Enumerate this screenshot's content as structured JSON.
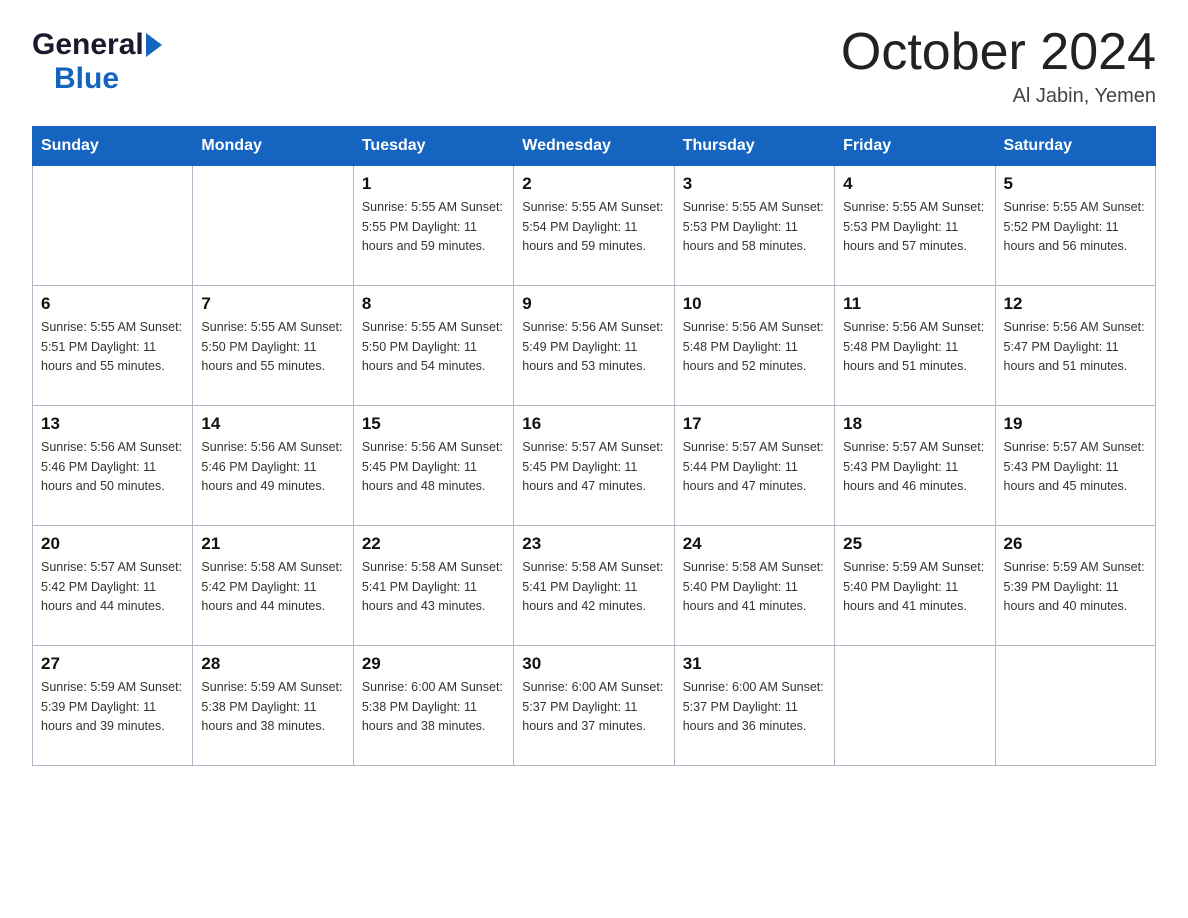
{
  "header": {
    "logo_general": "General",
    "logo_blue": "Blue",
    "title": "October 2024",
    "location": "Al Jabin, Yemen"
  },
  "weekdays": [
    "Sunday",
    "Monday",
    "Tuesday",
    "Wednesday",
    "Thursday",
    "Friday",
    "Saturday"
  ],
  "weeks": [
    [
      {
        "day": "",
        "info": ""
      },
      {
        "day": "",
        "info": ""
      },
      {
        "day": "1",
        "info": "Sunrise: 5:55 AM\nSunset: 5:55 PM\nDaylight: 11 hours\nand 59 minutes."
      },
      {
        "day": "2",
        "info": "Sunrise: 5:55 AM\nSunset: 5:54 PM\nDaylight: 11 hours\nand 59 minutes."
      },
      {
        "day": "3",
        "info": "Sunrise: 5:55 AM\nSunset: 5:53 PM\nDaylight: 11 hours\nand 58 minutes."
      },
      {
        "day": "4",
        "info": "Sunrise: 5:55 AM\nSunset: 5:53 PM\nDaylight: 11 hours\nand 57 minutes."
      },
      {
        "day": "5",
        "info": "Sunrise: 5:55 AM\nSunset: 5:52 PM\nDaylight: 11 hours\nand 56 minutes."
      }
    ],
    [
      {
        "day": "6",
        "info": "Sunrise: 5:55 AM\nSunset: 5:51 PM\nDaylight: 11 hours\nand 55 minutes."
      },
      {
        "day": "7",
        "info": "Sunrise: 5:55 AM\nSunset: 5:50 PM\nDaylight: 11 hours\nand 55 minutes."
      },
      {
        "day": "8",
        "info": "Sunrise: 5:55 AM\nSunset: 5:50 PM\nDaylight: 11 hours\nand 54 minutes."
      },
      {
        "day": "9",
        "info": "Sunrise: 5:56 AM\nSunset: 5:49 PM\nDaylight: 11 hours\nand 53 minutes."
      },
      {
        "day": "10",
        "info": "Sunrise: 5:56 AM\nSunset: 5:48 PM\nDaylight: 11 hours\nand 52 minutes."
      },
      {
        "day": "11",
        "info": "Sunrise: 5:56 AM\nSunset: 5:48 PM\nDaylight: 11 hours\nand 51 minutes."
      },
      {
        "day": "12",
        "info": "Sunrise: 5:56 AM\nSunset: 5:47 PM\nDaylight: 11 hours\nand 51 minutes."
      }
    ],
    [
      {
        "day": "13",
        "info": "Sunrise: 5:56 AM\nSunset: 5:46 PM\nDaylight: 11 hours\nand 50 minutes."
      },
      {
        "day": "14",
        "info": "Sunrise: 5:56 AM\nSunset: 5:46 PM\nDaylight: 11 hours\nand 49 minutes."
      },
      {
        "day": "15",
        "info": "Sunrise: 5:56 AM\nSunset: 5:45 PM\nDaylight: 11 hours\nand 48 minutes."
      },
      {
        "day": "16",
        "info": "Sunrise: 5:57 AM\nSunset: 5:45 PM\nDaylight: 11 hours\nand 47 minutes."
      },
      {
        "day": "17",
        "info": "Sunrise: 5:57 AM\nSunset: 5:44 PM\nDaylight: 11 hours\nand 47 minutes."
      },
      {
        "day": "18",
        "info": "Sunrise: 5:57 AM\nSunset: 5:43 PM\nDaylight: 11 hours\nand 46 minutes."
      },
      {
        "day": "19",
        "info": "Sunrise: 5:57 AM\nSunset: 5:43 PM\nDaylight: 11 hours\nand 45 minutes."
      }
    ],
    [
      {
        "day": "20",
        "info": "Sunrise: 5:57 AM\nSunset: 5:42 PM\nDaylight: 11 hours\nand 44 minutes."
      },
      {
        "day": "21",
        "info": "Sunrise: 5:58 AM\nSunset: 5:42 PM\nDaylight: 11 hours\nand 44 minutes."
      },
      {
        "day": "22",
        "info": "Sunrise: 5:58 AM\nSunset: 5:41 PM\nDaylight: 11 hours\nand 43 minutes."
      },
      {
        "day": "23",
        "info": "Sunrise: 5:58 AM\nSunset: 5:41 PM\nDaylight: 11 hours\nand 42 minutes."
      },
      {
        "day": "24",
        "info": "Sunrise: 5:58 AM\nSunset: 5:40 PM\nDaylight: 11 hours\nand 41 minutes."
      },
      {
        "day": "25",
        "info": "Sunrise: 5:59 AM\nSunset: 5:40 PM\nDaylight: 11 hours\nand 41 minutes."
      },
      {
        "day": "26",
        "info": "Sunrise: 5:59 AM\nSunset: 5:39 PM\nDaylight: 11 hours\nand 40 minutes."
      }
    ],
    [
      {
        "day": "27",
        "info": "Sunrise: 5:59 AM\nSunset: 5:39 PM\nDaylight: 11 hours\nand 39 minutes."
      },
      {
        "day": "28",
        "info": "Sunrise: 5:59 AM\nSunset: 5:38 PM\nDaylight: 11 hours\nand 38 minutes."
      },
      {
        "day": "29",
        "info": "Sunrise: 6:00 AM\nSunset: 5:38 PM\nDaylight: 11 hours\nand 38 minutes."
      },
      {
        "day": "30",
        "info": "Sunrise: 6:00 AM\nSunset: 5:37 PM\nDaylight: 11 hours\nand 37 minutes."
      },
      {
        "day": "31",
        "info": "Sunrise: 6:00 AM\nSunset: 5:37 PM\nDaylight: 11 hours\nand 36 minutes."
      },
      {
        "day": "",
        "info": ""
      },
      {
        "day": "",
        "info": ""
      }
    ]
  ]
}
